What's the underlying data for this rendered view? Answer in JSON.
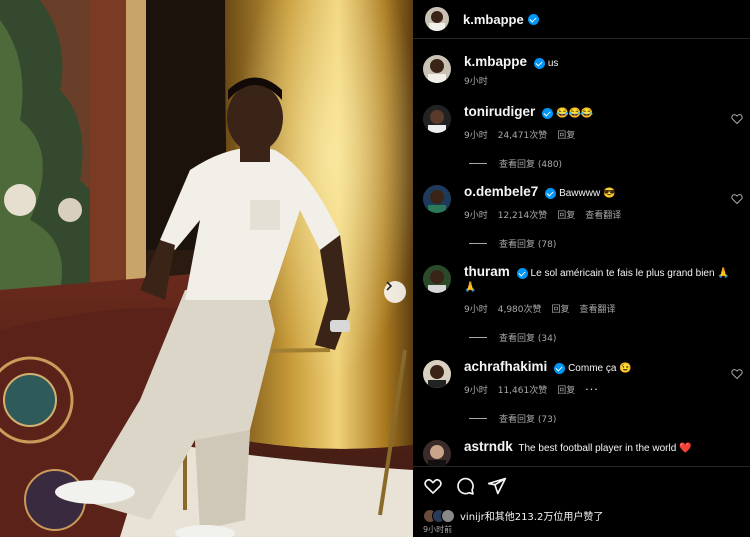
{
  "post": {
    "author": "k.mbappe",
    "caption": "us",
    "caption_time": "9小时"
  },
  "comments": [
    {
      "user": "tonirudiger",
      "text": "😂😂😂",
      "time": "9小时",
      "likes": "24,471次赞",
      "reply": "回复",
      "translate": "",
      "view_replies": "查看回复 (480)"
    },
    {
      "user": "o.dembele7",
      "text": "Bawwww 😎",
      "time": "9小时",
      "likes": "12,214次赞",
      "reply": "回复",
      "translate": "查看翻译",
      "view_replies": "查看回复 (78)"
    },
    {
      "user": "thuram",
      "text": "Le sol américain te fais le plus grand bien 🙏🙏",
      "time": "9小时",
      "likes": "4,980次赞",
      "reply": "回复",
      "translate": "查看翻译",
      "view_replies": "查看回复 (34)"
    },
    {
      "user": "achrafhakimi",
      "text": "Comme ça 😉",
      "time": "9小时",
      "likes": "11,461次赞",
      "reply": "回复",
      "translate": "",
      "more": "···",
      "view_replies": "查看回复 (73)"
    },
    {
      "user": "astrndk",
      "text": "The best football player in the world ❤️"
    }
  ],
  "likes_summary": "vinijr和其他213.2万位用户赞了",
  "post_time": "9小时前",
  "icons": {
    "like": "heart-icon",
    "comment": "comment-icon",
    "share": "share-icon",
    "next": "chevron-right-icon"
  },
  "colors": {
    "background": "#000000",
    "verified": "#0095f6",
    "secondary_text": "#a8a8a8",
    "gold_wall": "#b8892a"
  }
}
